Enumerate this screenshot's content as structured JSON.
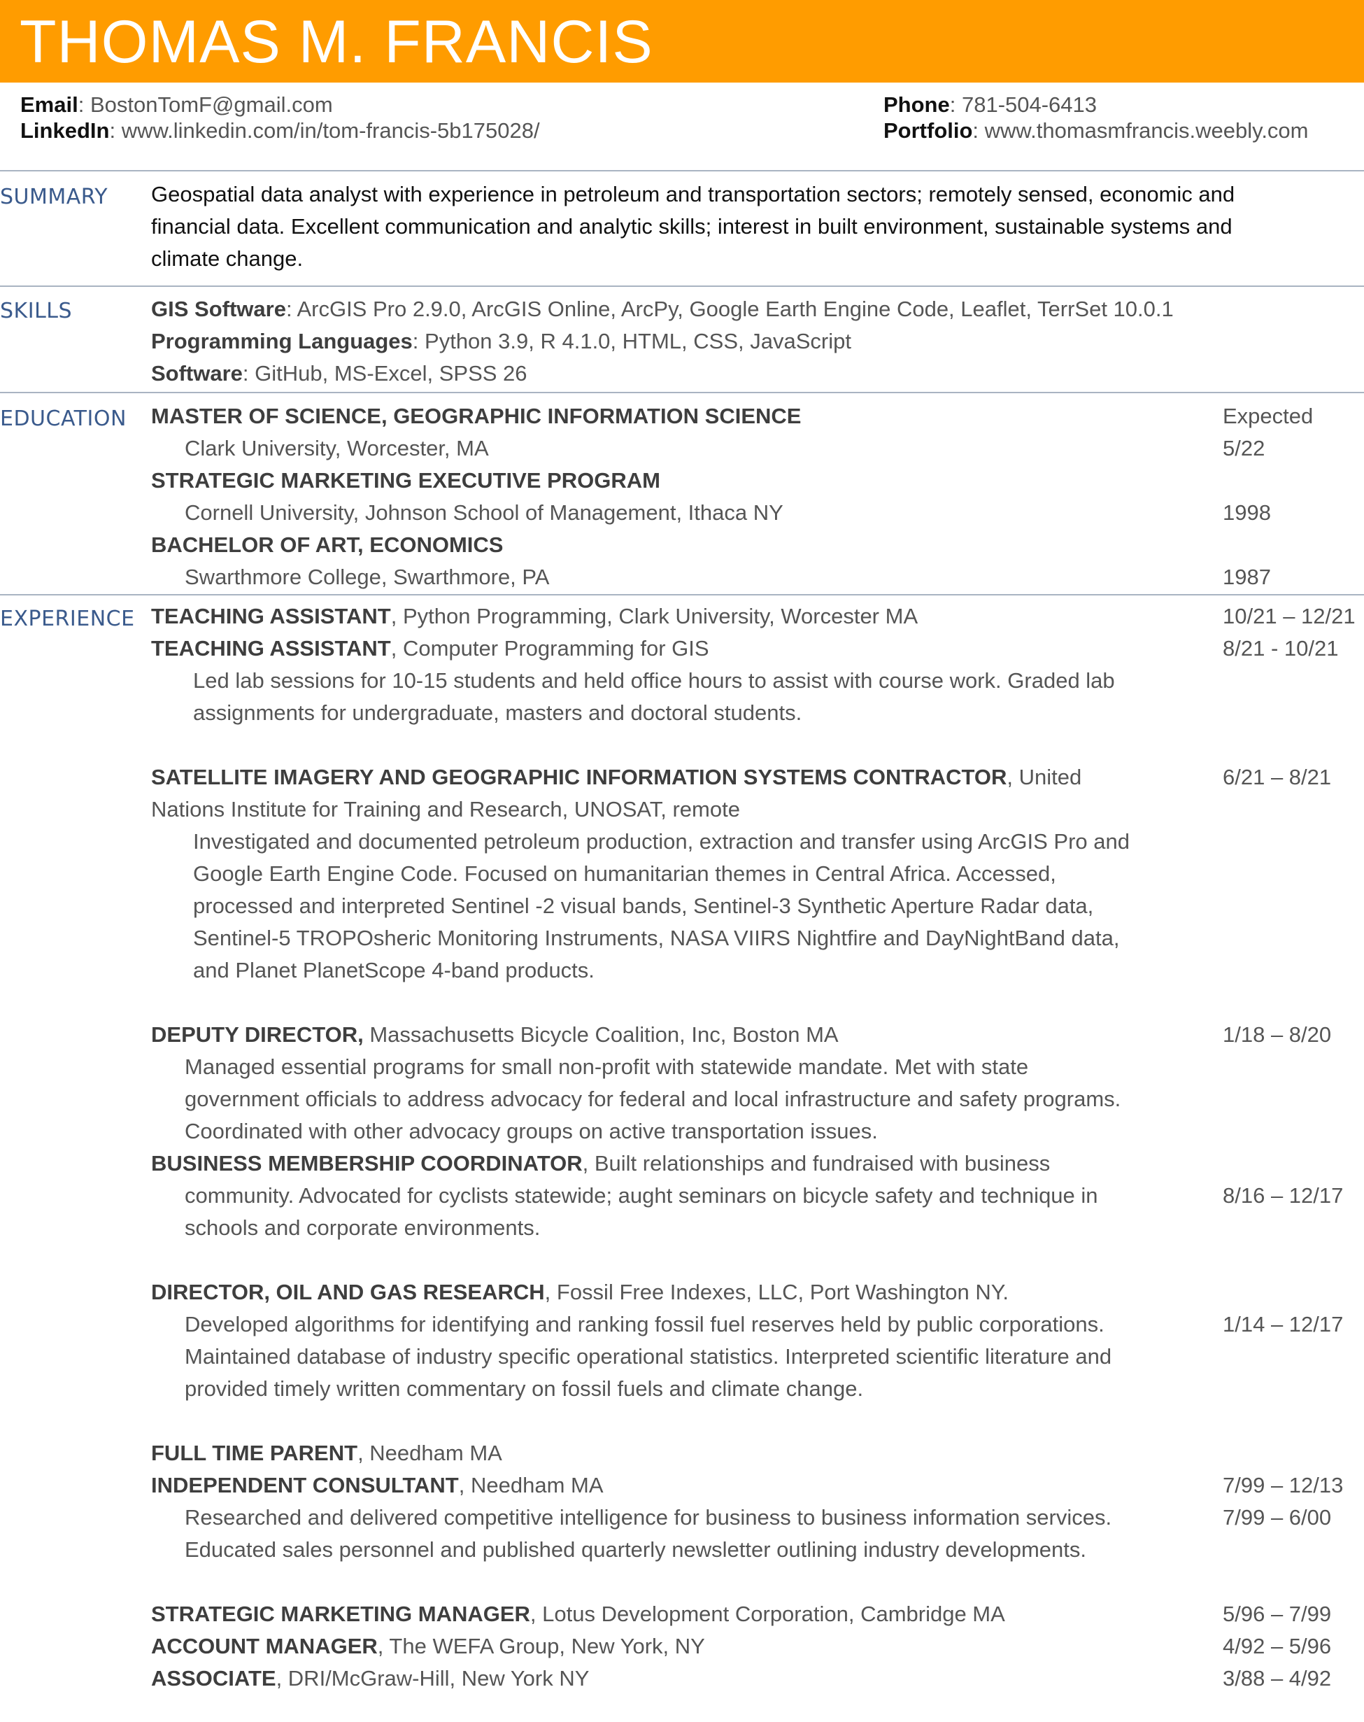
{
  "header": {
    "name": "THOMAS M. FRANCIS",
    "email_label": "Email",
    "email": "BostonTomF@gmail.com",
    "linkedin_label": "LinkedIn",
    "linkedin": "www.linkedin.com/in/tom-francis-5b175028/",
    "phone_label": "Phone",
    "phone": "781-504-6413",
    "portfolio_label": "Portfolio",
    "portfolio": "www.thomasmfrancis.weebly.com"
  },
  "summary": {
    "label": "SUMMARY",
    "lines": [
      "Geospatial data analyst with experience in petroleum and transportation sectors; remotely sensed, economic and",
      "financial data. Excellent communication and analytic skills; interest in built environment, sustainable systems and",
      "climate change."
    ]
  },
  "skills": {
    "label": "SKILLS",
    "items": [
      {
        "name": "GIS Software",
        "value": "ArcGIS Pro 2.9.0, ArcGIS Online, ArcPy, Google Earth Engine Code, Leaflet, TerrSet 10.0.1"
      },
      {
        "name": "Programming Languages",
        "value": "Python 3.9, R 4.1.0, HTML, CSS, JavaScript"
      },
      {
        "name": "Software",
        "value": "GitHub, MS-Excel, SPSS 26"
      }
    ]
  },
  "education": {
    "label": "EDUCATION",
    "entries": [
      {
        "degree": "MASTER OF SCIENCE, GEOGRAPHIC INFORMATION SCIENCE",
        "school": "Clark University, Worcester, MA",
        "date1": "Expected",
        "date2": "5/22"
      },
      {
        "degree": "STRATEGIC MARKETING EXECUTIVE PROGRAM",
        "school": "Cornell University, Johnson School of Management, Ithaca NY",
        "date": "1998"
      },
      {
        "degree": "BACHELOR OF ART, ECONOMICS",
        "school": "Swarthmore College, Swarthmore, PA",
        "date": "1987"
      }
    ]
  },
  "experience": {
    "label": "EXPERIENCE",
    "ta1": {
      "title": "TEACHING ASSISTANT",
      "org": ", Python Programming, Clark University, Worcester MA",
      "date": "10/21 – 12/21"
    },
    "ta2": {
      "title": "TEACHING ASSISTANT",
      "org": ", Computer Programming for GIS",
      "date": "8/21 - 10/21",
      "desc": [
        "Led lab sessions for 10-15 students and held office hours to assist with course work. Graded lab",
        "assignments for undergraduate, masters and doctoral students."
      ]
    },
    "sat": {
      "title": "SATELLITE IMAGERY AND GEOGRAPHIC INFORMATION SYSTEMS CONTRACTOR",
      "org1": ", United",
      "org2": "Nations Institute for Training and Research, UNOSAT, remote",
      "date": "6/21 – 8/21",
      "desc": [
        "Investigated and documented petroleum production, extraction and transfer using ArcGIS Pro and",
        "Google Earth Engine Code. Focused on humanitarian themes in Central Africa. Accessed,",
        "processed and interpreted Sentinel -2 visual bands, Sentinel-3 Synthetic Aperture Radar data,",
        "Sentinel-5 TROPOsheric Monitoring Instruments, NASA VIIRS Nightfire and DayNightBand data,",
        "and Planet PlanetScope 4-band products."
      ]
    },
    "deputy": {
      "title": "DEPUTY DIRECTOR,",
      "org": " Massachusetts Bicycle Coalition, Inc, Boston MA",
      "date": "1/18 – 8/20",
      "desc": [
        "Managed essential programs for small non-profit with statewide mandate. Met with state",
        "government officials to address advocacy for federal and local infrastructure and safety programs.",
        "Coordinated with other advocacy groups on active transportation issues."
      ]
    },
    "bmc": {
      "title": "BUSINESS MEMBERSHIP COORDINATOR",
      "org": ", Built relationships and fundraised with business",
      "date": "8/16 – 12/17",
      "desc": [
        "community. Advocated for cyclists statewide; aught seminars on bicycle safety and technique in",
        "schools and corporate environments."
      ]
    },
    "ogr": {
      "title": "DIRECTOR, OIL AND GAS RESEARCH",
      "org": ", Fossil Free Indexes, LLC, Port Washington NY.",
      "date": "1/14 – 12/17",
      "desc": [
        "Developed algorithms for identifying and ranking fossil fuel reserves held by public corporations.",
        "Maintained database of industry specific operational statistics. Interpreted scientific literature and",
        "provided timely written commentary on fossil fuels and climate change."
      ]
    },
    "parent": {
      "title": "FULL TIME PARENT",
      "org": ", Needham MA"
    },
    "consultant": {
      "title": "INDEPENDENT CONSULTANT",
      "org": ", Needham MA",
      "date": "7/99 – 12/13",
      "date2": "7/99 – 6/00",
      "desc": [
        "Researched and delivered competitive intelligence for business to business information services.",
        "Educated sales personnel and published quarterly newsletter outlining industry developments."
      ]
    },
    "smm": {
      "title": "STRATEGIC MARKETING MANAGER",
      "org": ", Lotus Development Corporation, Cambridge MA",
      "date": "5/96 – 7/99"
    },
    "am": {
      "title": "ACCOUNT MANAGER",
      "org": ", The WEFA Group, New York, NY",
      "date": "4/92 – 5/96"
    },
    "assoc": {
      "title": "ASSOCIATE",
      "org": ", DRI/McGraw-Hill, New York NY",
      "date": "3/88 – 4/92"
    }
  }
}
